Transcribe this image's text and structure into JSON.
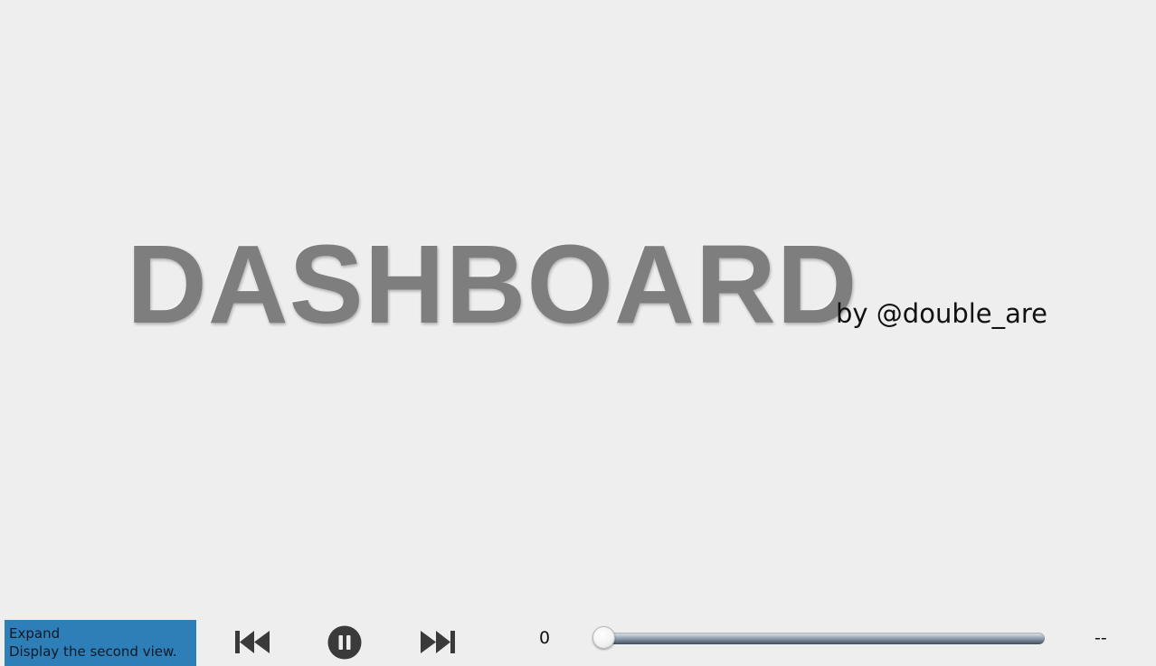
{
  "splash": {
    "title": "DASHBOARD",
    "byline": "by @double_are"
  },
  "expand_panel": {
    "title": "Expand",
    "description": "Display the second view."
  },
  "playback": {
    "previous_icon": "skip-back-icon",
    "pause_icon": "pause-icon",
    "next_icon": "skip-forward-icon",
    "current_value": "0",
    "total_value": "--",
    "slider_position": 0
  },
  "colors": {
    "background": "#eeeeee",
    "title": "#7e7e7e",
    "expand_panel": "#2e7fb8",
    "controls": "#3a3a3a"
  }
}
